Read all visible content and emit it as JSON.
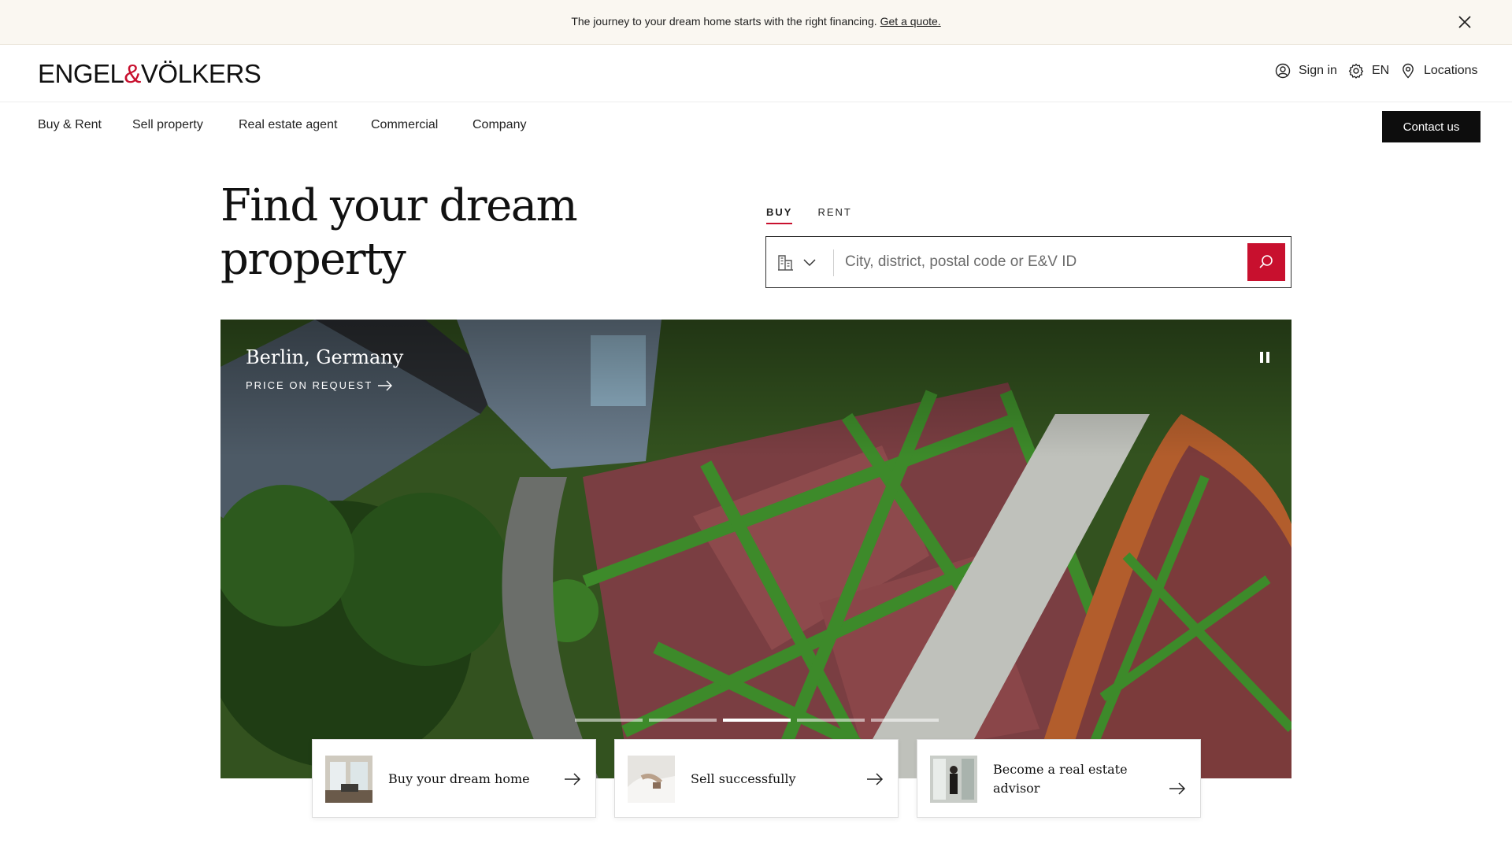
{
  "promo": {
    "text": "The journey to your dream home starts with the right financing.",
    "link": "Get a quote."
  },
  "header": {
    "logo_left": "ENGEL",
    "logo_amp": "&",
    "logo_right": "VÖLKERS",
    "signin": "Sign in",
    "language": "EN",
    "locations": "Locations"
  },
  "nav": {
    "items": [
      "Buy & Rent",
      "Sell property",
      "Real estate agent",
      "Commercial",
      "Company"
    ],
    "contact": "Contact us"
  },
  "hero": {
    "title": "Find your dream property"
  },
  "search": {
    "tabs": [
      "BUY",
      "RENT"
    ],
    "active_tab": "BUY",
    "placeholder": "City, district, postal code or E&V ID"
  },
  "slide": {
    "location": "Berlin, Germany",
    "price": "PRICE ON REQUEST",
    "slide_count": 5,
    "active_slide": 3
  },
  "cards": [
    {
      "label": "Buy your dream home"
    },
    {
      "label": "Sell successfully"
    },
    {
      "label": "Become a real estate advisor"
    }
  ],
  "colors": {
    "brand_red": "#c8102e",
    "promo_bg": "#faf7f1",
    "button_dark": "#0d0d0d"
  }
}
